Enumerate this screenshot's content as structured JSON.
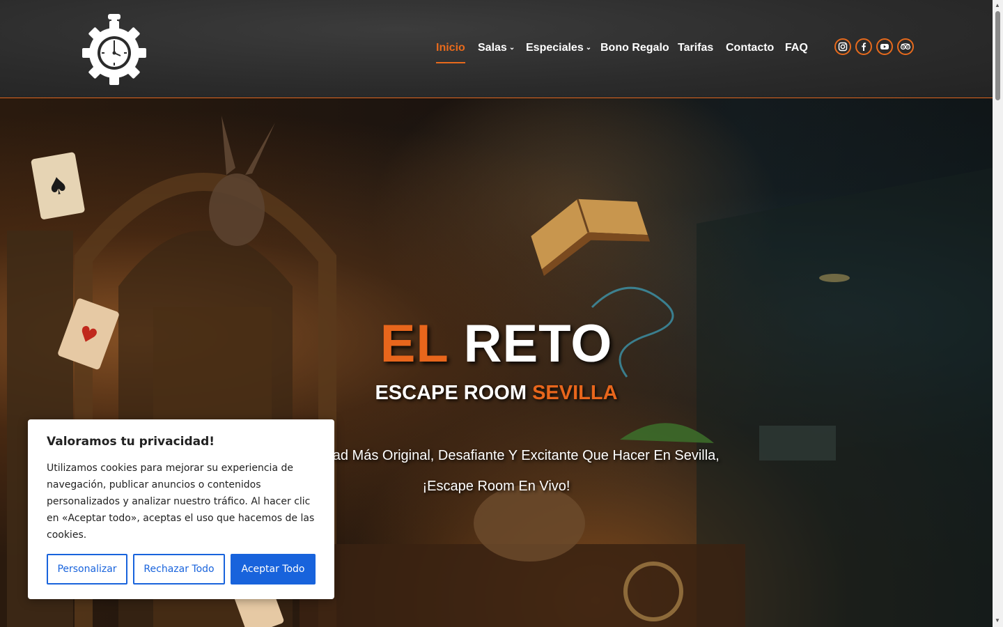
{
  "header": {
    "nav": [
      {
        "label": "Inicio",
        "active": true,
        "dropdown": false
      },
      {
        "label": "Salas",
        "active": false,
        "dropdown": true
      },
      {
        "label": "Especiales",
        "active": false,
        "dropdown": true
      },
      {
        "label": "Bono Regalo",
        "active": false,
        "dropdown": false
      },
      {
        "label": "Tarifas",
        "active": false,
        "dropdown": false
      },
      {
        "label": "Contacto",
        "active": false,
        "dropdown": false
      },
      {
        "label": "FAQ",
        "active": false,
        "dropdown": false
      }
    ],
    "social_icons": [
      "instagram-icon",
      "facebook-icon",
      "youtube-icon",
      "tripadvisor-icon"
    ]
  },
  "hero": {
    "title_part1": "EL",
    "title_part2": "RETO",
    "subtitle_part1": "ESCAPE ROOM",
    "subtitle_part2": "SEVILLA",
    "tagline_line1": "La Actividad Más Original, Desafiante Y Excitante Que Hacer En Sevilla,",
    "tagline_line2": "¡Escape Room En Vivo!"
  },
  "cookie_banner": {
    "title": "Valoramos tu privacidad!",
    "body": "Utilizamos cookies para mejorar su experiencia de navegación, publicar anuncios o contenidos personalizados y analizar nuestro tráfico. Al hacer clic en «Aceptar todo», aceptas el uso que hacemos de las cookies.",
    "customize_label": "Personalizar",
    "reject_label": "Rechazar Todo",
    "accept_label": "Aceptar Todo"
  },
  "colors": {
    "accent": "#e8661c",
    "cookie_button": "#1863dc",
    "header_bg": "#2b2b2b"
  }
}
